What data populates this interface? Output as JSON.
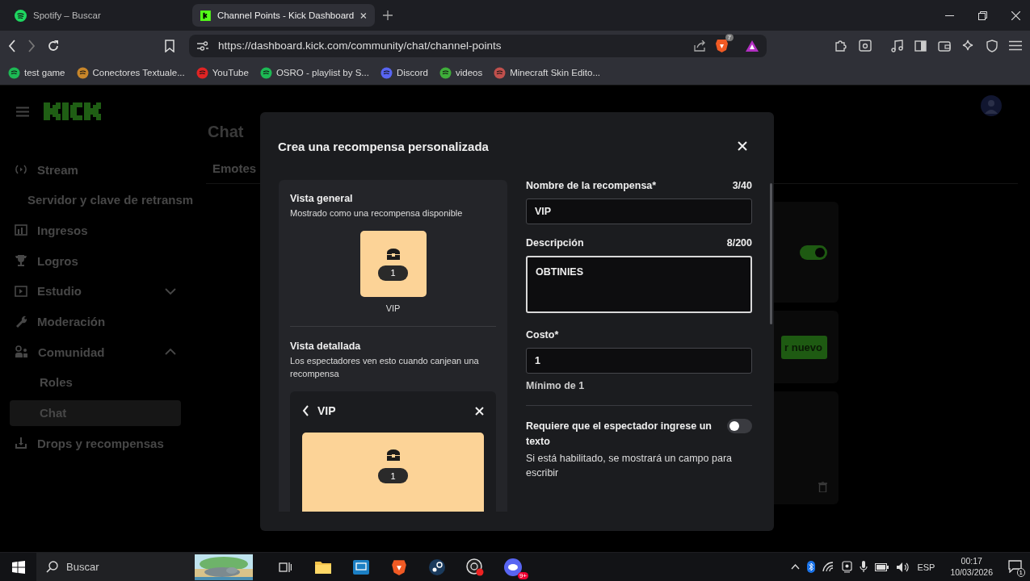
{
  "browser": {
    "tabs": [
      {
        "title": "Spotify – Buscar",
        "selected": false
      },
      {
        "title": "Channel Points - Kick Dashboard",
        "selected": true
      }
    ],
    "url": "https://dashboard.kick.com/community/chat/channel-points",
    "shield_badge": "7",
    "bookmarks": [
      {
        "label": "test game"
      },
      {
        "label": "Conectores Textuale..."
      },
      {
        "label": "YouTube"
      },
      {
        "label": "OSRO - playlist by S..."
      },
      {
        "label": "Discord"
      },
      {
        "label": "videos"
      },
      {
        "label": "Minecraft Skin Edito..."
      }
    ]
  },
  "sidebar": {
    "items": [
      {
        "label": "Stream",
        "kind": "item",
        "selected": false
      },
      {
        "label": "Servidor y clave de retransm",
        "kind": "sub",
        "selected": false
      },
      {
        "label": "Ingresos",
        "kind": "item",
        "selected": false
      },
      {
        "label": "Logros",
        "kind": "item",
        "selected": false
      },
      {
        "label": "Estudio",
        "kind": "group",
        "expanded": false,
        "selected": false
      },
      {
        "label": "Moderación",
        "kind": "item",
        "selected": false
      },
      {
        "label": "Comunidad",
        "kind": "group",
        "expanded": true,
        "selected": false
      },
      {
        "label": "Roles",
        "kind": "sub",
        "selected": false
      },
      {
        "label": "Chat",
        "kind": "sub",
        "selected": true
      },
      {
        "label": "Drops y recompensas",
        "kind": "item",
        "selected": false
      }
    ]
  },
  "page": {
    "heading": "Chat",
    "tabs": [
      "Emotes"
    ],
    "toggle_on": true,
    "button": "r nuevo"
  },
  "modal": {
    "title": "Crea una recompensa personalizada",
    "overview": {
      "title": "Vista general",
      "subtitle": "Mostrado como una recompensa disponible",
      "cost": "1",
      "name": "VIP"
    },
    "detail": {
      "title": "Vista detallada",
      "subtitle": "Los espectadores ven esto cuando canjean una recompensa",
      "header": "VIP",
      "cost": "1"
    },
    "fields": [
      {
        "kind": "input",
        "label": "Nombre de la recompensa*",
        "counter": "3/40",
        "value": "VIP",
        "focused": false
      },
      {
        "kind": "textarea",
        "label": "Descripción",
        "counter": "8/200",
        "value": "OBTINIES",
        "focused": true
      },
      {
        "kind": "input",
        "label": "Costo*",
        "value": "1",
        "hint": "Mínimo de 1",
        "focused": false
      }
    ],
    "setting": {
      "label": "Requiere que el espectador ingrese un texto",
      "description": "Si está habilitado, se mostrará un campo para escribir",
      "on": false
    }
  },
  "taskbar": {
    "search_placeholder": "Buscar",
    "discord_badge": "9+",
    "language": "ESP",
    "time": "00:17",
    "date": "10/03/2026",
    "notifications": "1"
  }
}
